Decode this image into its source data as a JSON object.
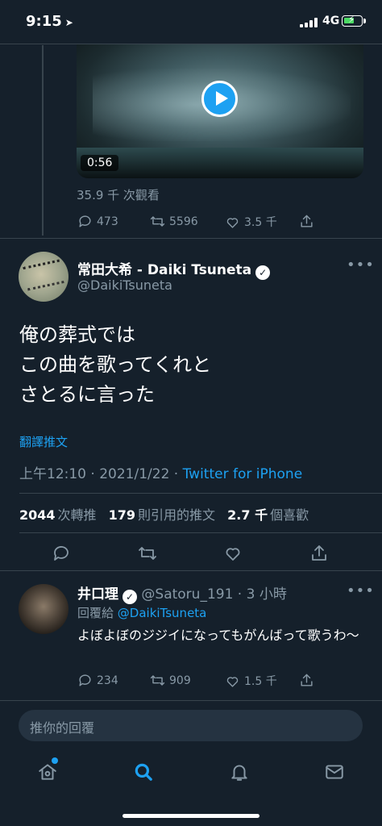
{
  "status_bar": {
    "time": "9:15",
    "network": "4G"
  },
  "prev_tweet": {
    "video_duration": "0:56",
    "views": "35.9 千 次觀看",
    "actions": {
      "replies": "473",
      "retweets": "5596",
      "likes": "3.5 千"
    }
  },
  "main_tweet": {
    "display_name": "常田大希 - Daiki Tsuneta",
    "handle": "@DaikiTsuneta",
    "text_lines": [
      "俺の葬式では",
      "この曲を歌ってくれと",
      "さとるに言った"
    ],
    "translate_label": "翻譯推文",
    "time": "上午12:10",
    "date": "2021/1/22",
    "source": "Twitter for iPhone",
    "stats": {
      "retweets_count": "2044",
      "retweets_label": "次轉推",
      "quotes_count": "179",
      "quotes_label": "則引用的推文",
      "likes_count": "2.7 千",
      "likes_label": "個喜歡"
    }
  },
  "reply_tweet": {
    "display_name": "井口理",
    "handle": "@Satoru_191",
    "time_ago": "3 小時",
    "replying_label": "回覆給",
    "replying_to": "@DaikiTsuneta",
    "text": "よぼよぼのジジイになってもがんばって歌うわ〜",
    "actions": {
      "replies": "234",
      "retweets": "909",
      "likes": "1.5 千"
    }
  },
  "reply_box": {
    "placeholder": "推你的回覆"
  },
  "colors": {
    "background": "#15202b",
    "accent": "#1da1f2",
    "muted": "#8899a6"
  }
}
